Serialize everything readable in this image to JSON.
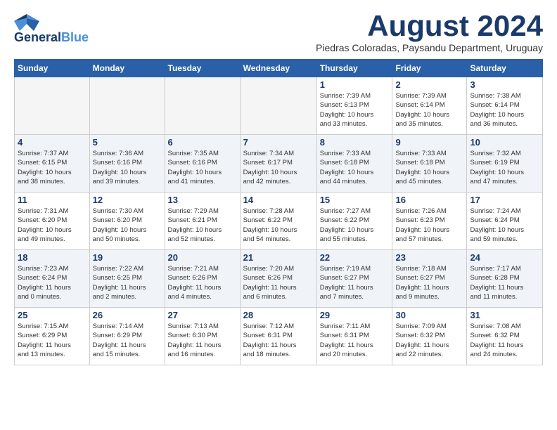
{
  "header": {
    "logo_line1": "General",
    "logo_line2": "Blue",
    "month_title": "August 2024",
    "subtitle": "Piedras Coloradas, Paysandu Department, Uruguay"
  },
  "weekdays": [
    "Sunday",
    "Monday",
    "Tuesday",
    "Wednesday",
    "Thursday",
    "Friday",
    "Saturday"
  ],
  "weeks": [
    [
      {
        "day": "",
        "info": ""
      },
      {
        "day": "",
        "info": ""
      },
      {
        "day": "",
        "info": ""
      },
      {
        "day": "",
        "info": ""
      },
      {
        "day": "1",
        "info": "Sunrise: 7:39 AM\nSunset: 6:13 PM\nDaylight: 10 hours\nand 33 minutes."
      },
      {
        "day": "2",
        "info": "Sunrise: 7:39 AM\nSunset: 6:14 PM\nDaylight: 10 hours\nand 35 minutes."
      },
      {
        "day": "3",
        "info": "Sunrise: 7:38 AM\nSunset: 6:14 PM\nDaylight: 10 hours\nand 36 minutes."
      }
    ],
    [
      {
        "day": "4",
        "info": "Sunrise: 7:37 AM\nSunset: 6:15 PM\nDaylight: 10 hours\nand 38 minutes."
      },
      {
        "day": "5",
        "info": "Sunrise: 7:36 AM\nSunset: 6:16 PM\nDaylight: 10 hours\nand 39 minutes."
      },
      {
        "day": "6",
        "info": "Sunrise: 7:35 AM\nSunset: 6:16 PM\nDaylight: 10 hours\nand 41 minutes."
      },
      {
        "day": "7",
        "info": "Sunrise: 7:34 AM\nSunset: 6:17 PM\nDaylight: 10 hours\nand 42 minutes."
      },
      {
        "day": "8",
        "info": "Sunrise: 7:33 AM\nSunset: 6:18 PM\nDaylight: 10 hours\nand 44 minutes."
      },
      {
        "day": "9",
        "info": "Sunrise: 7:33 AM\nSunset: 6:18 PM\nDaylight: 10 hours\nand 45 minutes."
      },
      {
        "day": "10",
        "info": "Sunrise: 7:32 AM\nSunset: 6:19 PM\nDaylight: 10 hours\nand 47 minutes."
      }
    ],
    [
      {
        "day": "11",
        "info": "Sunrise: 7:31 AM\nSunset: 6:20 PM\nDaylight: 10 hours\nand 49 minutes."
      },
      {
        "day": "12",
        "info": "Sunrise: 7:30 AM\nSunset: 6:20 PM\nDaylight: 10 hours\nand 50 minutes."
      },
      {
        "day": "13",
        "info": "Sunrise: 7:29 AM\nSunset: 6:21 PM\nDaylight: 10 hours\nand 52 minutes."
      },
      {
        "day": "14",
        "info": "Sunrise: 7:28 AM\nSunset: 6:22 PM\nDaylight: 10 hours\nand 54 minutes."
      },
      {
        "day": "15",
        "info": "Sunrise: 7:27 AM\nSunset: 6:22 PM\nDaylight: 10 hours\nand 55 minutes."
      },
      {
        "day": "16",
        "info": "Sunrise: 7:26 AM\nSunset: 6:23 PM\nDaylight: 10 hours\nand 57 minutes."
      },
      {
        "day": "17",
        "info": "Sunrise: 7:24 AM\nSunset: 6:24 PM\nDaylight: 10 hours\nand 59 minutes."
      }
    ],
    [
      {
        "day": "18",
        "info": "Sunrise: 7:23 AM\nSunset: 6:24 PM\nDaylight: 11 hours\nand 0 minutes."
      },
      {
        "day": "19",
        "info": "Sunrise: 7:22 AM\nSunset: 6:25 PM\nDaylight: 11 hours\nand 2 minutes."
      },
      {
        "day": "20",
        "info": "Sunrise: 7:21 AM\nSunset: 6:26 PM\nDaylight: 11 hours\nand 4 minutes."
      },
      {
        "day": "21",
        "info": "Sunrise: 7:20 AM\nSunset: 6:26 PM\nDaylight: 11 hours\nand 6 minutes."
      },
      {
        "day": "22",
        "info": "Sunrise: 7:19 AM\nSunset: 6:27 PM\nDaylight: 11 hours\nand 7 minutes."
      },
      {
        "day": "23",
        "info": "Sunrise: 7:18 AM\nSunset: 6:27 PM\nDaylight: 11 hours\nand 9 minutes."
      },
      {
        "day": "24",
        "info": "Sunrise: 7:17 AM\nSunset: 6:28 PM\nDaylight: 11 hours\nand 11 minutes."
      }
    ],
    [
      {
        "day": "25",
        "info": "Sunrise: 7:15 AM\nSunset: 6:29 PM\nDaylight: 11 hours\nand 13 minutes."
      },
      {
        "day": "26",
        "info": "Sunrise: 7:14 AM\nSunset: 6:29 PM\nDaylight: 11 hours\nand 15 minutes."
      },
      {
        "day": "27",
        "info": "Sunrise: 7:13 AM\nSunset: 6:30 PM\nDaylight: 11 hours\nand 16 minutes."
      },
      {
        "day": "28",
        "info": "Sunrise: 7:12 AM\nSunset: 6:31 PM\nDaylight: 11 hours\nand 18 minutes."
      },
      {
        "day": "29",
        "info": "Sunrise: 7:11 AM\nSunset: 6:31 PM\nDaylight: 11 hours\nand 20 minutes."
      },
      {
        "day": "30",
        "info": "Sunrise: 7:09 AM\nSunset: 6:32 PM\nDaylight: 11 hours\nand 22 minutes."
      },
      {
        "day": "31",
        "info": "Sunrise: 7:08 AM\nSunset: 6:32 PM\nDaylight: 11 hours\nand 24 minutes."
      }
    ]
  ]
}
